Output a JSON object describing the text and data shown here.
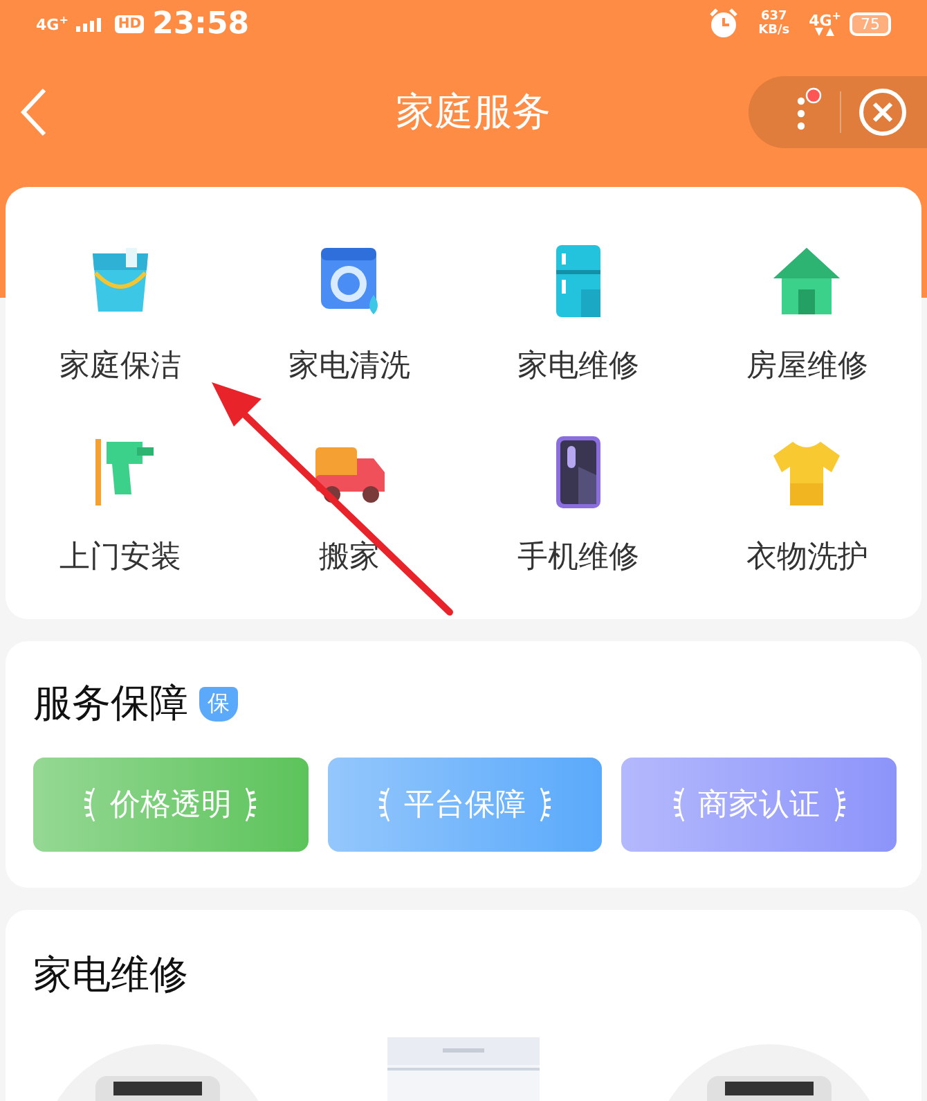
{
  "status_bar": {
    "network_left": "4G",
    "network_left_plus": "+",
    "network_right_plus": "+",
    "hd": "HD",
    "time": "23:58",
    "speed": "637",
    "speed_unit": "KB/s",
    "network_right": "4G",
    "battery": "75"
  },
  "header": {
    "title": "家庭服务",
    "notification": true
  },
  "services": [
    {
      "label": "家庭保洁",
      "kind": "bucket"
    },
    {
      "label": "家电清洗",
      "kind": "washer"
    },
    {
      "label": "家电维修",
      "kind": "fridge"
    },
    {
      "label": "房屋维修",
      "kind": "house"
    },
    {
      "label": "上门安装",
      "kind": "drill"
    },
    {
      "label": "搬家",
      "kind": "truck"
    },
    {
      "label": "手机维修",
      "kind": "phone"
    },
    {
      "label": "衣物洗护",
      "kind": "shirt"
    }
  ],
  "guarantee": {
    "title": "服务保障",
    "badge": "保",
    "items": [
      {
        "label": "价格透明",
        "color": "#5cc35a"
      },
      {
        "label": "平台保障",
        "color": "#5aa9fb"
      },
      {
        "label": "商家认证",
        "color": "#8c94fa"
      }
    ]
  },
  "repair": {
    "title": "家电维修"
  }
}
